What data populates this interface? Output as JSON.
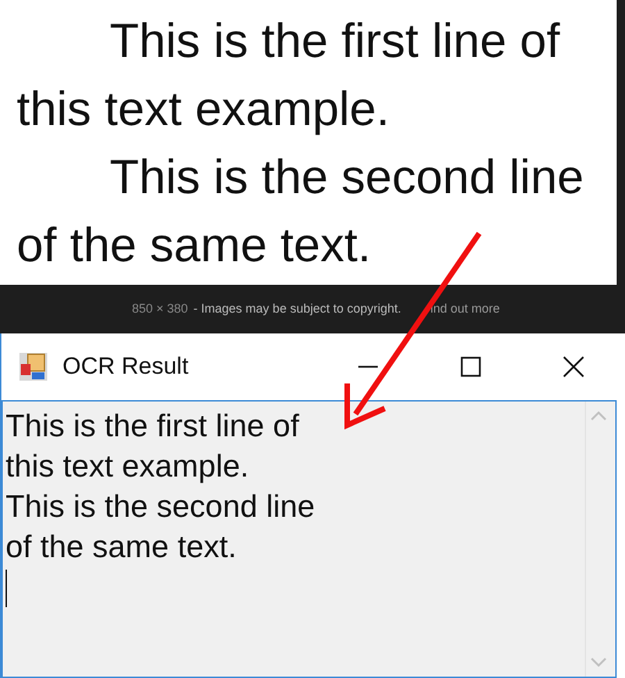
{
  "document_image": {
    "paragraphs": [
      {
        "lines": [
          "This is the first line of",
          "this text example."
        ]
      },
      {
        "lines": [
          "This is the second line",
          "of the same text."
        ]
      }
    ]
  },
  "image_caption": {
    "size": "850 × 380",
    "notice": "- Images may be subject to copyright.",
    "link": "ind out more"
  },
  "window": {
    "title": "OCR Result",
    "buttons": [
      {
        "kind": "minimize"
      },
      {
        "kind": "maximize"
      },
      {
        "kind": "close"
      }
    ],
    "text_box": {
      "lines": [
        "This is the first line of",
        "this text example.",
        "This is the second line",
        "of the same text."
      ]
    }
  }
}
